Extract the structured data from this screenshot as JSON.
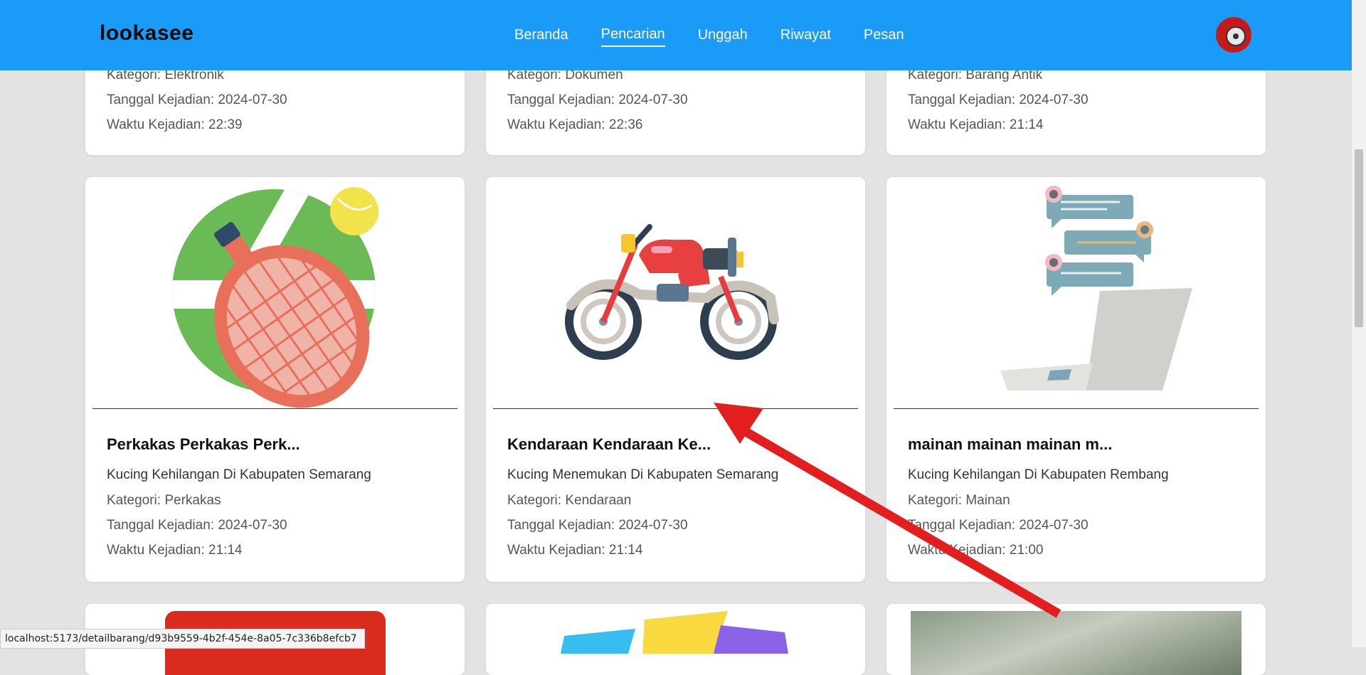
{
  "navbar": {
    "brand": "lookasee",
    "links": [
      "Beranda",
      "Pencarian",
      "Unggah",
      "Riwayat",
      "Pesan"
    ],
    "active": "Pencarian"
  },
  "top_row": [
    {
      "kategori": "Kategori: Elektronik",
      "tanggal": "Tanggal Kejadian: 2024-07-30",
      "waktu": "Waktu Kejadian: 22:39"
    },
    {
      "kategori": "Kategori: Dokumen",
      "tanggal": "Tanggal Kejadian: 2024-07-30",
      "waktu": "Waktu Kejadian: 22:36"
    },
    {
      "kategori": "Kategori: Barang Antik",
      "tanggal": "Tanggal Kejadian: 2024-07-30",
      "waktu": "Waktu Kejadian: 21:14"
    }
  ],
  "cards": [
    {
      "title": "Perkakas Perkakas Perk...",
      "desc": "Kucing Kehilangan Di Kabupaten Semarang",
      "kategori": "Kategori: Perkakas",
      "tanggal": "Tanggal Kejadian: 2024-07-30",
      "waktu": "Waktu Kejadian: 21:14",
      "icon": "tennis-racket-icon"
    },
    {
      "title": "Kendaraan Kendaraan Ke...",
      "desc": "Kucing Menemukan Di Kabupaten Semarang",
      "kategori": "Kategori: Kendaraan",
      "tanggal": "Tanggal Kejadian: 2024-07-30",
      "waktu": "Waktu Kejadian: 21:14",
      "icon": "motorcycle-icon"
    },
    {
      "title": "mainan mainan mainan m...",
      "desc": "Kucing Kehilangan Di Kabupaten Rembang",
      "kategori": "Kategori: Mainan",
      "tanggal": "Tanggal Kejadian: 2024-07-30",
      "waktu": "Waktu Kejadian: 21:00",
      "icon": "laptop-chat-icon"
    }
  ],
  "status_bar": {
    "url": "localhost:5173/detailbarang/d93b9559-4b2f-454e-8a05-7c336b8efcb7"
  },
  "colors": {
    "navbar": "#1a9bf7",
    "arrow": "#e31e1e",
    "background": "#e3e3e3"
  }
}
